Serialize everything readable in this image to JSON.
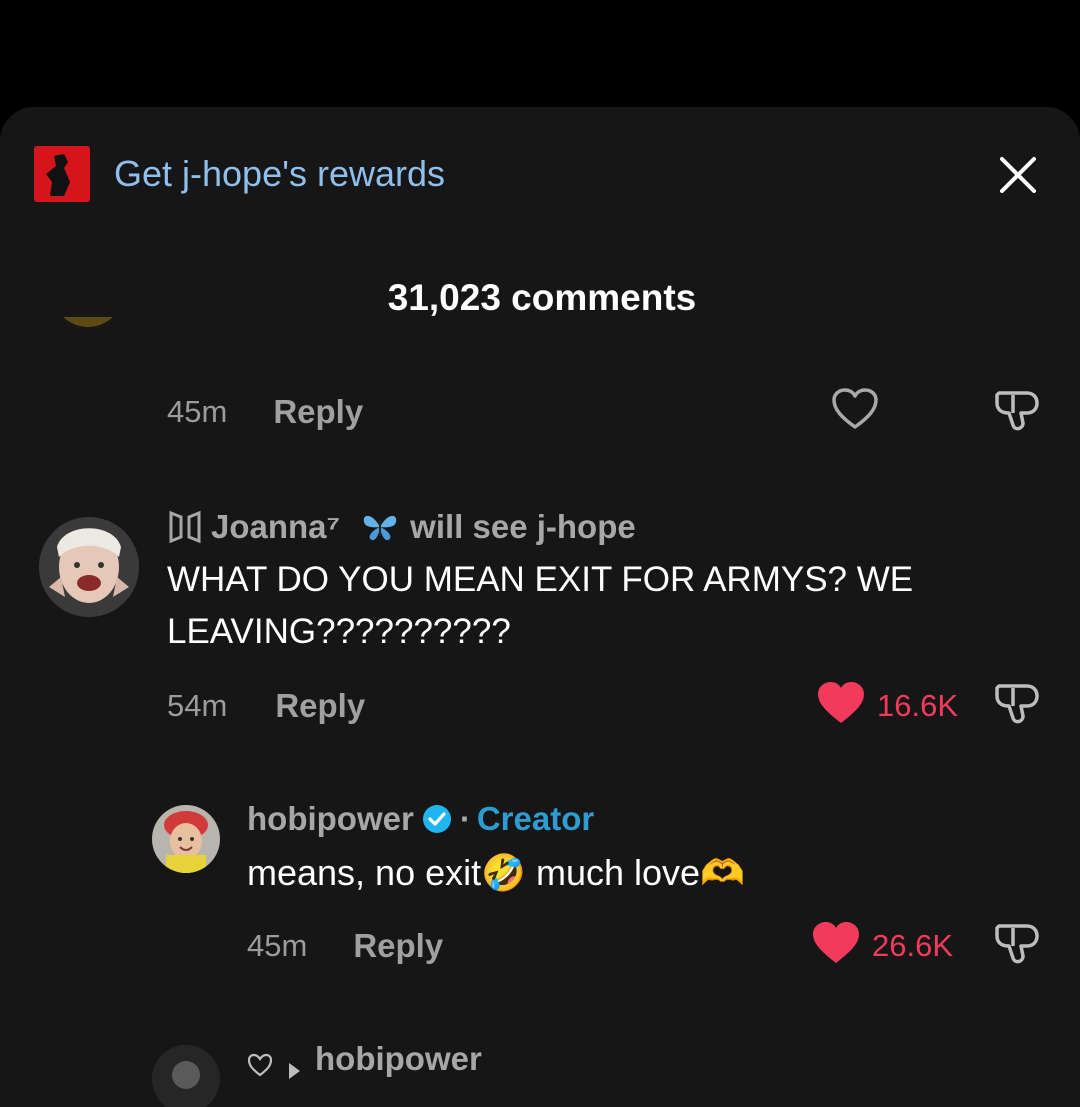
{
  "banner": {
    "text": "Get j-hope's rewards"
  },
  "header": {
    "title": "31,023 comments"
  },
  "comments": [
    {
      "time": "45m",
      "reply_label": "Reply"
    },
    {
      "username": "Joanna⁷",
      "username_suffix": "will see j-hope",
      "text_line1": "WHAT DO YOU MEAN EXIT FOR ARMYS? WE",
      "text_line2": "LEAVING??????????",
      "time": "54m",
      "reply_label": "Reply",
      "likes": "16.6K"
    }
  ],
  "replies": [
    {
      "username": "hobipower",
      "separator": "·",
      "badge": "Creator",
      "text": "means, no exit🤣 much love🫶",
      "time": "45m",
      "reply_label": "Reply",
      "likes": "26.6K"
    },
    {
      "username": "hobipower"
    }
  ],
  "colors": {
    "like": "#f23a5c",
    "creator": "#2d9cd1",
    "banner_text": "#8fbfec",
    "background": "#161616"
  },
  "icons": [
    "close-icon",
    "heart-outline-icon",
    "heart-filled-icon",
    "dislike-icon",
    "verified-badge-icon",
    "bts-logo-icon",
    "butterfly-icon",
    "small-heart-icon",
    "play-triangle-icon"
  ]
}
